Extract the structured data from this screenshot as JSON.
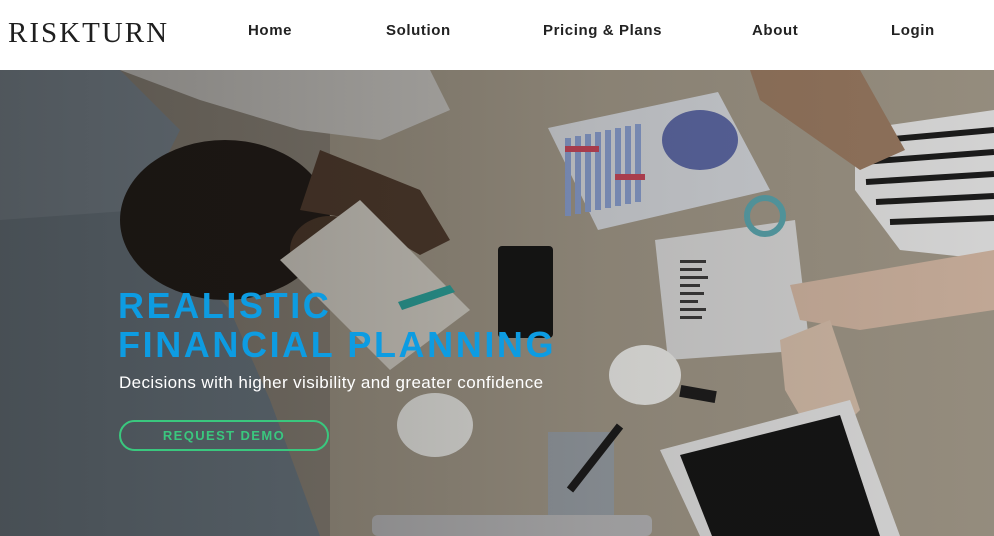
{
  "brand": {
    "logo_text": "RISKTURN"
  },
  "nav": {
    "items": [
      {
        "label": "Home"
      },
      {
        "label": "Solution"
      },
      {
        "label": "Pricing & Plans"
      },
      {
        "label": "About"
      },
      {
        "label": "Login"
      }
    ]
  },
  "hero": {
    "headline_line1": "REALISTIC",
    "headline_line2": "FINANCIAL PLANNING",
    "subheadline": "Decisions with higher visibility and greater confidence",
    "cta_label": "REQUEST DEMO"
  },
  "colors": {
    "accent_blue": "#0d9ce2",
    "cta_green": "#3ac77e",
    "header_bg": "#ffffff",
    "logo_text": "#1f1f1f"
  }
}
